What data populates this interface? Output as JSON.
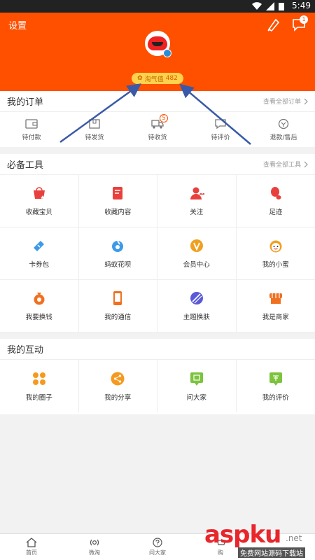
{
  "status_bar": {
    "time": "5:49"
  },
  "header": {
    "settings_label": "设置",
    "taoqi_label": "淘气值",
    "taoqi_value": "482",
    "msg_badge": "1"
  },
  "orders": {
    "title": "我的订单",
    "more": "查看全部订单",
    "items": [
      {
        "label": "待付款",
        "icon": "wallet-icon"
      },
      {
        "label": "待发货",
        "icon": "box-icon"
      },
      {
        "label": "待收货",
        "icon": "truck-icon",
        "badge": "5"
      },
      {
        "label": "待评价",
        "icon": "comment-icon"
      },
      {
        "label": "退款/售后",
        "icon": "refund-icon"
      }
    ]
  },
  "tools": {
    "title": "必备工具",
    "more": "查看全部工具",
    "items": [
      {
        "label": "收藏宝贝",
        "icon": "favorite-bag-icon",
        "color": "#e8413d"
      },
      {
        "label": "收藏内容",
        "icon": "favorite-content-icon",
        "color": "#e8413d"
      },
      {
        "label": "关注",
        "icon": "follow-icon",
        "color": "#e8413d"
      },
      {
        "label": "足迹",
        "icon": "footprint-icon",
        "color": "#e8413d"
      },
      {
        "label": "卡券包",
        "icon": "coupon-icon",
        "color": "#3d9ae8"
      },
      {
        "label": "蚂蚁花呗",
        "icon": "huabei-icon",
        "color": "#3d9ae8"
      },
      {
        "label": "会员中心",
        "icon": "vip-icon",
        "color": "#f0a020"
      },
      {
        "label": "我的小蜜",
        "icon": "assistant-icon",
        "color": "#f0a020"
      },
      {
        "label": "我要换钱",
        "icon": "money-bag-icon",
        "color": "#f07020"
      },
      {
        "label": "我的通信",
        "icon": "phone-icon",
        "color": "#f07020"
      },
      {
        "label": "主题换肤",
        "icon": "theme-icon",
        "color": "#5a5ad8"
      },
      {
        "label": "我是商家",
        "icon": "shop-icon",
        "color": "#f07020"
      }
    ]
  },
  "interact": {
    "title": "我的互动",
    "items": [
      {
        "label": "我的圈子",
        "icon": "circle-icon",
        "color": "#f59a20"
      },
      {
        "label": "我的分享",
        "icon": "share-icon",
        "color": "#f59a20"
      },
      {
        "label": "问大家",
        "icon": "ask-icon",
        "color": "#7cc33e"
      },
      {
        "label": "我的评价",
        "icon": "review-icon",
        "color": "#7cc33e"
      }
    ]
  },
  "tabbar": {
    "items": [
      {
        "label": "首页",
        "icon": "home-icon"
      },
      {
        "label": "微淘",
        "icon": "weitao-icon"
      },
      {
        "label": "问大家",
        "icon": "question-icon"
      },
      {
        "label": "购",
        "icon": "cart-icon"
      }
    ]
  },
  "watermark": {
    "brand": "aspku",
    "net": ".net",
    "sub": "免费网站源码下载站"
  }
}
